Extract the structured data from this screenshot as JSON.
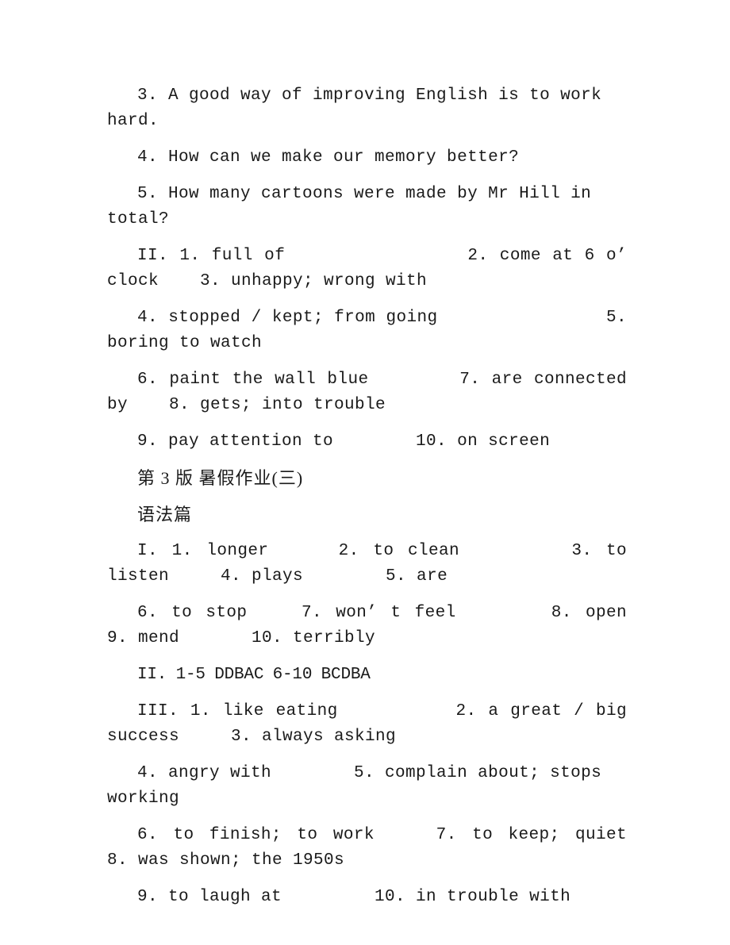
{
  "document": {
    "page_label": "第 3 版 暑假作业(三)",
    "section_label": "语法篇",
    "blocks": [
      {
        "id": "q3",
        "kind": "answer-line",
        "justified": false,
        "tight": false,
        "text": "3. A good way of improving English is to work hard."
      },
      {
        "id": "q4",
        "kind": "answer-line",
        "justified": false,
        "tight": false,
        "text": "4. How can we make our memory better?"
      },
      {
        "id": "q5",
        "kind": "answer-line",
        "justified": false,
        "tight": false,
        "text": "5. How many cartoons were made by Mr Hill in total?"
      },
      {
        "id": "ii-1-3",
        "kind": "answer-line",
        "justified": true,
        "tight": false,
        "text": "II. 1. full of                2. come at 6 o’ clock    3. unhappy; wrong with"
      },
      {
        "id": "ii-4-5",
        "kind": "answer-line",
        "justified": true,
        "tight": false,
        "text": "4. stopped / kept; from going                5. boring to watch"
      },
      {
        "id": "ii-6-8",
        "kind": "answer-line",
        "justified": true,
        "tight": false,
        "text": "6. paint the wall blue        7. are connected by    8. gets; into trouble"
      },
      {
        "id": "ii-9-10",
        "kind": "answer-line",
        "justified": false,
        "tight": false,
        "text": "9. pay attention to        10. on screen"
      },
      {
        "id": "page-heading",
        "kind": "cn-heading",
        "justified": false,
        "tight": false,
        "text": "第 3 版 暑假作业(三)"
      },
      {
        "id": "section-heading",
        "kind": "cn-heading",
        "justified": false,
        "tight": false,
        "text": "语法篇"
      },
      {
        "id": "i-1-5",
        "kind": "answer-line",
        "justified": true,
        "tight": false,
        "text": "I. 1. longer     2. to clean        3. to listen     4. plays        5. are"
      },
      {
        "id": "i-6-10",
        "kind": "answer-line",
        "justified": true,
        "tight": false,
        "text": "6. to stop    7. won’ t feel       8. open      9. mend       10. terribly"
      },
      {
        "id": "ii-choices",
        "kind": "answer-line",
        "justified": false,
        "tight": true,
        "text": "II. 1-5 DDBAC 6-10 BCDBA"
      },
      {
        "id": "iii-1-3",
        "kind": "answer-line",
        "justified": true,
        "tight": false,
        "text": "III. 1. like eating          2. a great / big success     3. always asking"
      },
      {
        "id": "iii-4-5",
        "kind": "answer-line",
        "justified": false,
        "tight": false,
        "text": "4. angry with        5. complain about; stops working"
      },
      {
        "id": "iii-6-8",
        "kind": "answer-line",
        "justified": true,
        "tight": false,
        "text": "6. to finish; to work    7. to keep; quiet               8. was shown; the 1950s"
      },
      {
        "id": "iii-9-10",
        "kind": "answer-line",
        "justified": false,
        "tight": false,
        "text": "9. to laugh at         10. in trouble with"
      }
    ]
  },
  "style": {
    "text_color": "#1a1a1a",
    "page_background": "#ffffff"
  }
}
